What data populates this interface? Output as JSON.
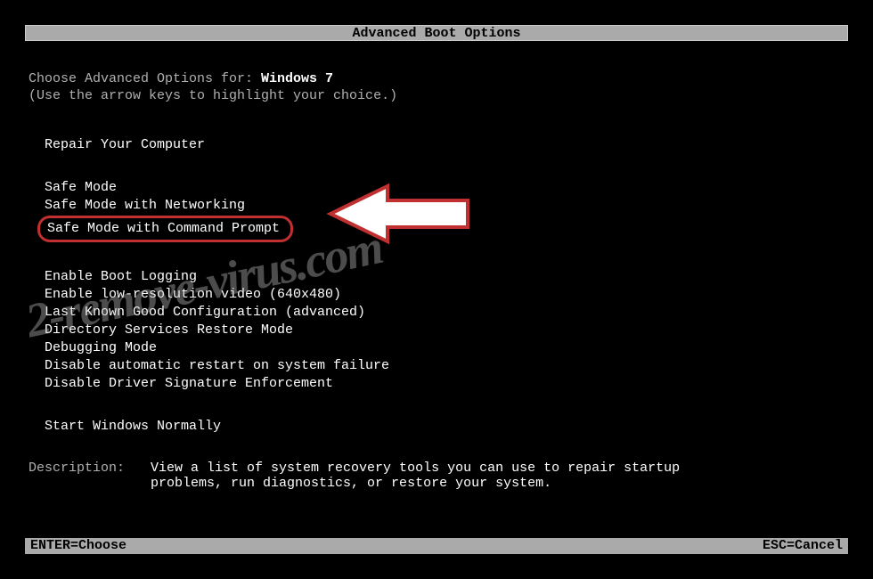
{
  "title": "Advanced Boot Options",
  "choose_prefix": "Choose Advanced Options for: ",
  "os_name": "Windows 7",
  "instruction": "(Use the arrow keys to highlight your choice.)",
  "menu": {
    "repair": "Repair Your Computer",
    "safe_mode": "Safe Mode",
    "safe_mode_net": "Safe Mode with Networking",
    "safe_mode_cmd": "Safe Mode with Command Prompt",
    "boot_logging": "Enable Boot Logging",
    "low_res": "Enable low-resolution video (640x480)",
    "lkgc": "Last Known Good Configuration (advanced)",
    "dsrm": "Directory Services Restore Mode",
    "debug": "Debugging Mode",
    "no_restart": "Disable automatic restart on system failure",
    "no_sig": "Disable Driver Signature Enforcement",
    "normal": "Start Windows Normally"
  },
  "description": {
    "label": "Description:",
    "text": "View a list of system recovery tools you can use to repair startup problems, run diagnostics, or restore your system."
  },
  "footer": {
    "enter": "ENTER=Choose",
    "esc": "ESC=Cancel"
  },
  "watermark": "2-remove-virus.com"
}
